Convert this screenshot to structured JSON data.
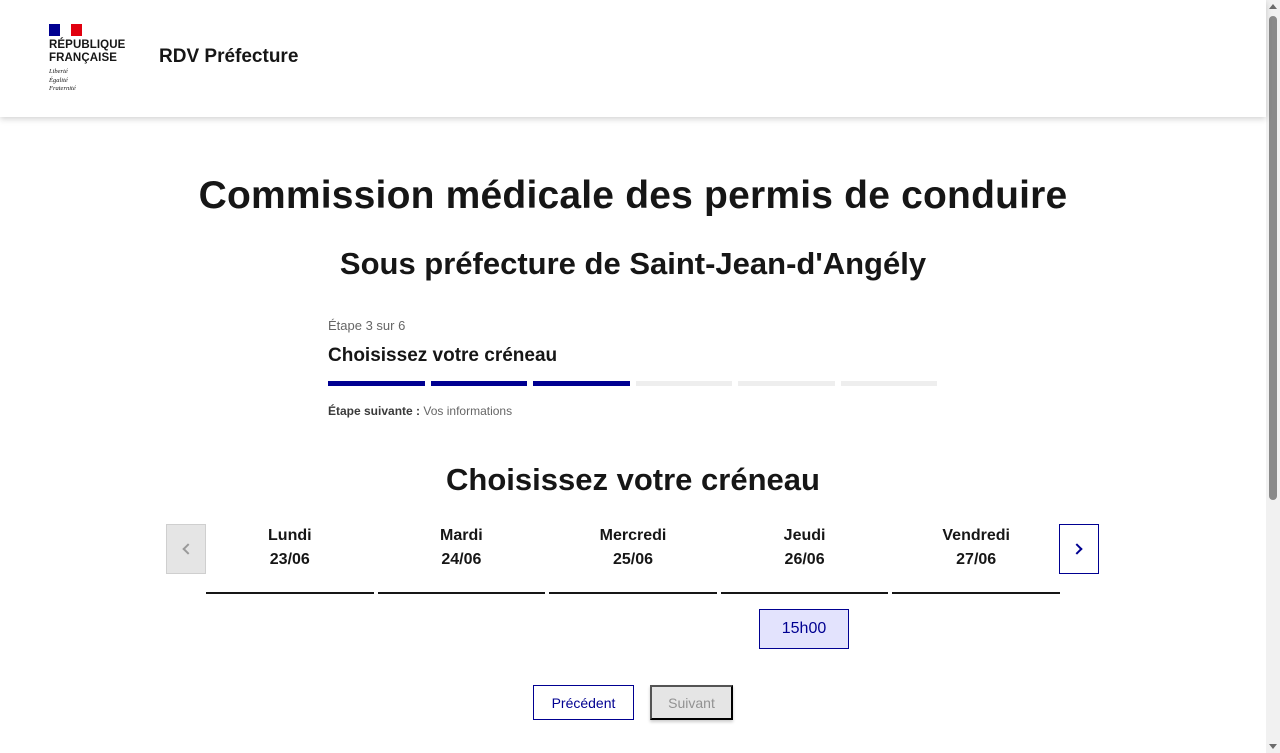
{
  "header": {
    "logo_lines": [
      "RÉPUBLIQUE",
      "FRANÇAISE"
    ],
    "motto": [
      "Liberté",
      "Égalité",
      "Fraternité"
    ],
    "site_title": "RDV Préfecture"
  },
  "main": {
    "title": "Commission médicale des permis de conduire",
    "subtitle": "Sous préfecture de Saint-Jean-d'Angély"
  },
  "stepper": {
    "state": "Étape 3 sur 6",
    "current_title": "Choisissez votre créneau",
    "current_step": 3,
    "total_steps": 6,
    "next_label": "Étape suivante :",
    "next_value": "Vos informations"
  },
  "calendar": {
    "section_title": "Choisissez votre créneau",
    "days": [
      {
        "name": "Lundi",
        "date": "23/06"
      },
      {
        "name": "Mardi",
        "date": "24/06"
      },
      {
        "name": "Mercredi",
        "date": "25/06"
      },
      {
        "name": "Jeudi",
        "date": "26/06"
      },
      {
        "name": "Vendredi",
        "date": "27/06"
      }
    ],
    "slots": [
      {
        "day": "Jeudi",
        "time": "15h00"
      }
    ],
    "prev_icon": "chevron-left-icon",
    "next_icon": "chevron-right-icon"
  },
  "actions": {
    "previous_label": "Précédent",
    "next_label": "Suivant"
  },
  "colors": {
    "primary": "#000091",
    "slot_bg": "#e3e3fd",
    "disabled_bg": "#e5e5e5",
    "flag_red": "#e1000f"
  }
}
